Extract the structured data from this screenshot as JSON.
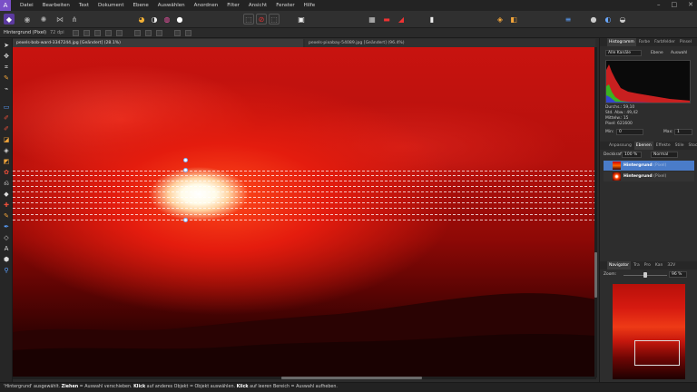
{
  "menubar": {
    "logo": "A",
    "items": [
      "Datei",
      "Bearbeiten",
      "Text",
      "Dokument",
      "Ebene",
      "Auswählen",
      "Anordnen",
      "Filter",
      "Ansicht",
      "Fenster",
      "Hilfe"
    ],
    "controls": [
      "–",
      "□",
      "✕"
    ]
  },
  "context": {
    "layer_label": "Hintergrund (Pixel)",
    "dpi": "72 dpi"
  },
  "tabs": [
    "pexels-bob-ward-3347244.jpg [Geändert] (28.1%)",
    "pexels-pixabay-54089.jpg [Geändert] (96.4%)"
  ],
  "panel": {
    "top_tabs": [
      "Histogramm",
      "Farbe",
      "Farbfelder",
      "Pinsel"
    ],
    "channel": "Alle Kanäle",
    "options": [
      "Ebene",
      "Auswahl"
    ],
    "stats": [
      "Durchs.: 59,10",
      "Std. Abw.: 49,42",
      "Mittelw.: 15",
      "Pixel: 621600"
    ],
    "min_label": "Min:",
    "min_value": "0",
    "max_label": "Max:",
    "max_value": "1",
    "layer_tabs": [
      "Anpassung",
      "Ebenen",
      "Effekte",
      "Stile",
      "Stock"
    ],
    "opacity_label": "Deckkraft:",
    "opacity_value": "100 %",
    "blend_mode": "Normal",
    "layers": [
      {
        "name": "Hintergrund",
        "kind": "(Pixel)"
      },
      {
        "name": "Hintergrund",
        "kind": "(Pixel)"
      }
    ],
    "nav_tabs": [
      "Navigator",
      "Tra",
      "Pro",
      "Kan",
      "32V"
    ],
    "zoom_label": "Zoom:",
    "zoom_value": "96 %"
  },
  "status": {
    "part1": "'Hintergrund' ausgewählt. ",
    "b1": "Ziehen",
    "part2": " = Auswahl verschieben. ",
    "b2": "Klick",
    "part3": " auf anderes Objekt = Objekt auswählen. ",
    "b3": "Klick",
    "part4": " auf leeren Bereich = Auswahl aufheben."
  }
}
